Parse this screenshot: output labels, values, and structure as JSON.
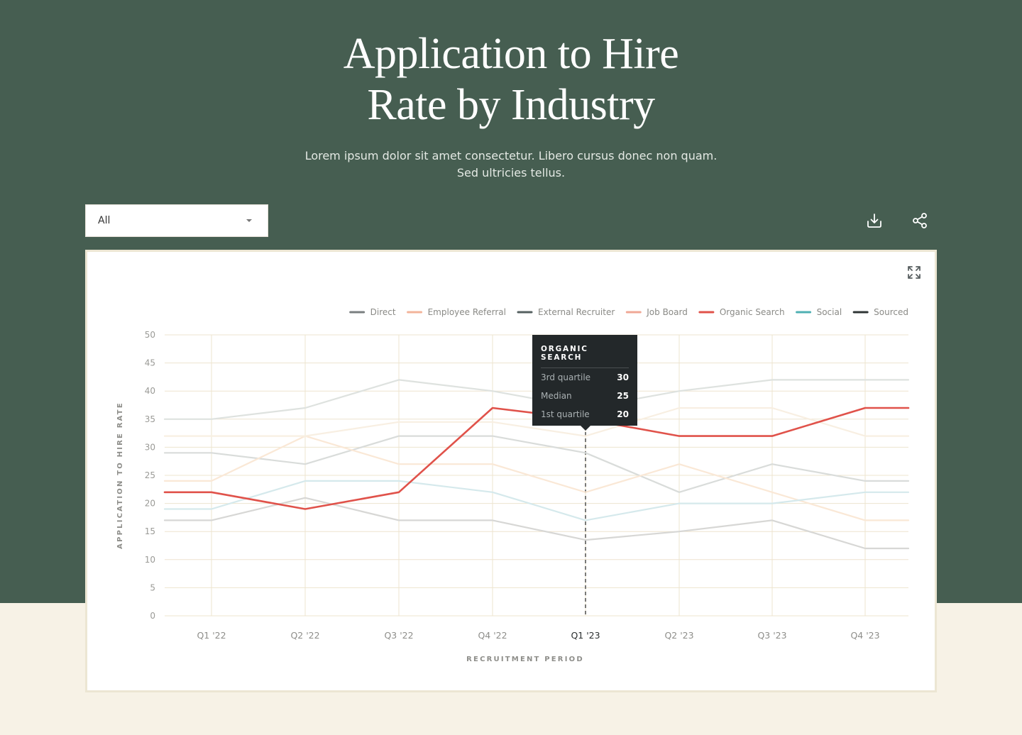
{
  "page": {
    "title_line1": "Application to Hire",
    "title_line2": "Rate by Industry",
    "subtitle_line1": "Lorem ipsum dolor sit amet consectetur. Libero cursus donec non quam.",
    "subtitle_line2": "Sed ultricies tellus."
  },
  "filter": {
    "selected": "All"
  },
  "toolbar": {
    "download_icon": "download-icon",
    "share_icon": "share-icon",
    "expand_icon": "expand-icon"
  },
  "colors": {
    "hero_background": "#465e51",
    "page_background": "#f7f2e6",
    "grid": "#ede4cf",
    "highlight": "#e0524a",
    "tooltip_background": "#23282a"
  },
  "tooltip": {
    "title": "ORGANIC SEARCH",
    "rows": [
      {
        "label": "3rd quartile",
        "value": "30"
      },
      {
        "label": "Median",
        "value": "25"
      },
      {
        "label": "1st quartile",
        "value": "20"
      }
    ]
  },
  "chart_data": {
    "type": "line",
    "title": "",
    "xlabel": "RECRUITMENT PERIOD",
    "ylabel": "APPLICATION TO HIRE RATE",
    "ylim": [
      0,
      50
    ],
    "yticks": [
      0,
      5,
      10,
      15,
      20,
      25,
      30,
      35,
      40,
      45,
      50
    ],
    "categories": [
      "Q1 '22",
      "Q2 '22",
      "Q3 '22",
      "Q4 '22",
      "Q1 '23",
      "Q2 '23",
      "Q3 '23",
      "Q4 '23"
    ],
    "highlighted_category": "Q1 '23",
    "highlighted_series": "Organic Search",
    "grid": true,
    "legend_position": "top-right",
    "legend": [
      {
        "name": "Direct",
        "color": "#7a7f80"
      },
      {
        "name": "Employee Referral",
        "color": "#f3b49a"
      },
      {
        "name": "External Recruiter",
        "color": "#556060"
      },
      {
        "name": "Job Board",
        "color": "#f0a896"
      },
      {
        "name": "Organic Search",
        "color": "#e0524a"
      },
      {
        "name": "Social",
        "color": "#4fb0b3"
      },
      {
        "name": "Sourced",
        "color": "#2f3535"
      }
    ],
    "series": [
      {
        "name": "Direct",
        "values": [
          29,
          27,
          32,
          32,
          29,
          22,
          27,
          24
        ],
        "color": "#d9dcda"
      },
      {
        "name": "Employee Referral",
        "values": [
          24,
          32,
          27,
          27,
          22,
          27,
          22,
          17
        ],
        "color": "#fae8d6"
      },
      {
        "name": "External Recruiter",
        "values": [
          35,
          37,
          42,
          40,
          37,
          40,
          42,
          42
        ],
        "color": "#dee2df"
      },
      {
        "name": "Job Board",
        "values": [
          32,
          32,
          34.5,
          34.5,
          32,
          37,
          37,
          32
        ],
        "color": "#f8efe2"
      },
      {
        "name": "Organic Search",
        "values": [
          22,
          22,
          19,
          22,
          37,
          35,
          32,
          32,
          37,
          37
        ],
        "x": [
          0.7,
          0,
          1,
          2,
          3,
          4,
          5,
          6,
          7,
          7.45
        ],
        "color": "#e0524a"
      },
      {
        "name": "Social",
        "values": [
          19,
          24,
          24,
          22,
          17,
          20,
          20,
          22
        ],
        "color": "#d5e9ec"
      },
      {
        "name": "Sourced",
        "values": [
          17,
          21,
          17,
          17,
          13.5,
          15,
          17,
          12
        ],
        "color": "#d7d7d5"
      }
    ]
  }
}
